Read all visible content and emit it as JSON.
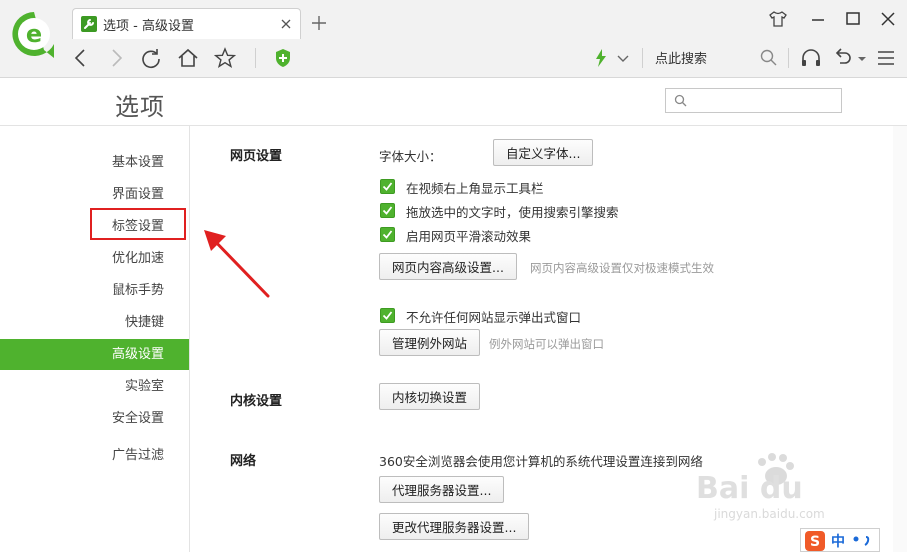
{
  "tab": {
    "title": "选项 - 高级设置"
  },
  "toolbar": {
    "search_label": "点此搜索"
  },
  "page": {
    "title": "选项",
    "search_placeholder": ""
  },
  "sidebar": {
    "items": [
      {
        "label": "基本设置"
      },
      {
        "label": "界面设置"
      },
      {
        "label": "标签设置"
      },
      {
        "label": "优化加速"
      },
      {
        "label": "鼠标手势"
      },
      {
        "label": "快捷键"
      },
      {
        "label": "高级设置"
      },
      {
        "label": "实验室"
      },
      {
        "label": "安全设置"
      },
      {
        "label": "广告过滤"
      }
    ],
    "active_index": 6
  },
  "web_settings": {
    "title": "网页设置",
    "font_size_label": "字体大小：",
    "custom_font_button": "自定义字体...",
    "checkboxes": [
      {
        "label": "在视频右上角显示工具栏",
        "checked": true
      },
      {
        "label": "拖放选中的文字时，使用搜索引擎搜索",
        "checked": true
      },
      {
        "label": "启用网页平滑滚动效果",
        "checked": true
      }
    ],
    "advanced_button": "网页内容高级设置...",
    "advanced_hint": "网页内容高级设置仅对极速模式生效",
    "popup_checkbox": {
      "label": "不允许任何网站显示弹出式窗口",
      "checked": true
    },
    "exceptions_button": "管理例外网站",
    "exceptions_hint": "例外网站可以弹出窗口"
  },
  "kernel_settings": {
    "title": "内核设置",
    "switch_button": "内核切换设置"
  },
  "network": {
    "title": "网络",
    "description": "360安全浏览器会使用您计算机的系统代理设置连接到网络",
    "proxy_button": "代理服务器设置...",
    "change_proxy_button": "更改代理服务器设置..."
  },
  "ime": {
    "label": "中"
  },
  "colors": {
    "accent": "#4fb22e",
    "highlight": "#e02020"
  }
}
